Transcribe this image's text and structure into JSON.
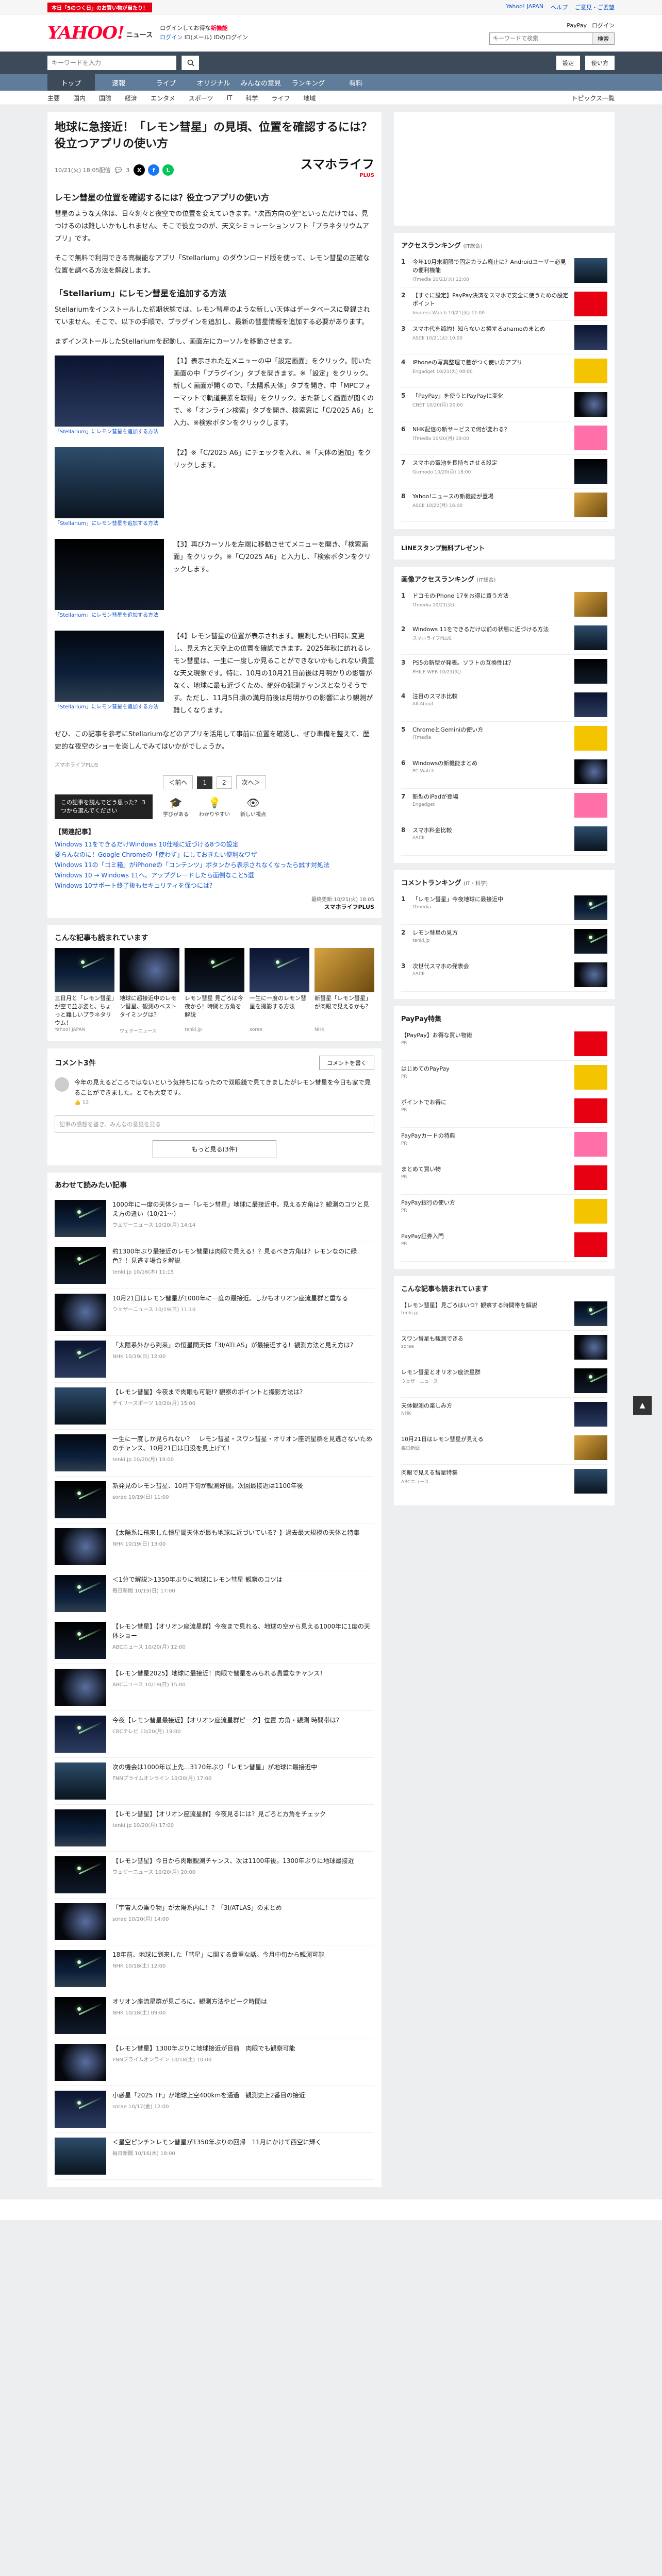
{
  "topbar": {
    "promo": "本日「5のつく日」のお買い物が当たり！",
    "links": [
      "Yahoo! JAPAN",
      "ヘルプ",
      "ご意見・ご要望"
    ]
  },
  "header": {
    "logo": "YAHOO!",
    "logo_sub": "JAPAN",
    "service": "ニュース",
    "line1_prefix": "ログインしてお得な",
    "line1_strong": "新機能",
    "line2": "ログイン",
    "line2_b": "ID(メール)",
    "line2_c": "IDのログイン",
    "search_placeholder": "キーワードで検索",
    "search_btn": "検索",
    "pay": "PayPay",
    "login": "ログイン"
  },
  "band": {
    "placeholder": "キーワードを入力",
    "settings": "設定",
    "help": "使い方"
  },
  "nav": [
    "トップ",
    "速報",
    "ライブ",
    "オリジナル",
    "みんなの意見",
    "ランキング",
    "有料"
  ],
  "subnav": [
    "主要",
    "国内",
    "国際",
    "経済",
    "エンタメ",
    "スポーツ",
    "IT",
    "科学",
    "ライフ",
    "地域"
  ],
  "subnav_topics": "トピックス一覧",
  "article": {
    "title": "地球に急接近！「レモン彗星」の見頃、位置を確認するには？役立つアプリの使い方",
    "date": "10/21(火) 18:05配信",
    "comments": "3",
    "media": "スマホライフ",
    "media_sub": "PLUS",
    "h2a": "レモン彗星の位置を確認するには？役立つアプリの使い方",
    "p1": "彗星のような天体は、日々刻々と夜空での位置を変えていきます。\"次西方向の空\"といっただけでは、見つけるのは難しいかもしれません。そこで役立つのが、天文シミュレーションソフト「プラネタリウムアプリ」です。",
    "p2": "そこで無料で利用できる高機能なアプリ「Stellarium」のダウンロード版を使って、レモン彗星の正確な位置を調べる方法を解説します。",
    "h2b": "「Stellarium」にレモン彗星を追加する方法",
    "p3": "Stellariumをインストールした初期状態では、レモン彗星のような新しい天体はデータベースに登録されていません。そこで、以下の手順で、プラグインを追加し、最新の彗星情報を追加する必要があります。",
    "p4": "まずインストールしたStellariumを起動し、画面左にカーソルを移動させます。",
    "steps": [
      {
        "text": "【1】表示された左メニューの中「設定画面」をクリック。開いた画面の中「プラグイン」タブを開きます。※「設定」をクリック。新しく画面が開くので、「太陽系天体」タブを開き、中「MPCフォーマットで軌道要素を取得」をクリック。また新しく画面が開くので、※「オンライン検索」タブを開き、検索窓に「C/2025 A6」と入力、※検索ボタンをクリックします。",
        "cap": "「Stellarium」にレモン彗星を追加する方法"
      },
      {
        "text": "【2】※「C/2025 A6」にチェックを入れ、※「天体の追加」をクリックします。",
        "cap": "「Stellarium」にレモン彗星を追加する方法"
      },
      {
        "text": "【3】再びカーソルを左端に移動させてメニューを開き、「検索画面」をクリック。※「C/2025 A6」と入力し、「検索ボタンをクリックします。",
        "cap": "「Stellarium」にレモン彗星を追加する方法"
      },
      {
        "text": "【4】レモン彗星の位置が表示されます。観測したい日時に変更し、見え方と天空上の位置を確認できます。2025年秋に訪れるレモン彗星は、一生に一度しか見ることができないかもしれない貴重な天文現象です。特に、10月の10月21日前後は月明かりの影響がなく、地球に最も近づくため、絶好の観測チャンスとなりそうです。ただし、11月5日頃の満月前後は月明かりの影響により観測が難しくなります。",
        "cap": "「Stellarium」にレモン彗星を追加する方法"
      }
    ],
    "p5": "ぜひ、この記事を参考にStellariumなどのアプリを活用して事前に位置を確認し、ぜひ準備を整えて、歴史的な夜空のショーを楽しんでみてはいかがでしょうか。",
    "writer": "スマホライフPLUS",
    "pager": [
      "＜前へ",
      "1",
      "2",
      "次へ＞"
    ],
    "quiz": "この記事を読んでどう思った？ 3つから選んでください",
    "reactions": [
      "学びがある",
      "わかりやすい",
      "新しい視点"
    ],
    "related_head": "【関連記事】",
    "related": [
      "Windows 11をできるだけWindows 10仕様に近づける8つの設定",
      "要らんなのに！Google Chromeの「使わず」にしておきたい便利なワザ",
      "Windows 11の「ゴミ箱」がiPhoneの「コンテンツ」ボタンから表示されなくなったら試す対処法",
      "Windows 10 → Windows 11へ、アップグレードしたら面倒なこと5選",
      "Windows 10サポート終了後もセキュリティを保つには？"
    ],
    "byline_date": "最終更新:10/21(火) 18:05",
    "byline_media": "スマホライフPLUS"
  },
  "recommend": {
    "head": "こんな記事も読まれています",
    "items": [
      {
        "title": "三日月と「レモン彗星」が空で並ぶ姿と、ちょっと難しいプラネタリウム！",
        "src": "Yahoo! JAPAN"
      },
      {
        "title": "地球に超接近中のレモン彗星、観測のベストタイミングは？",
        "src": "ウェザーニュース"
      },
      {
        "title": "レモン彗星 見ごろは今夜から！時間と方角を解説",
        "src": "tenki.jp"
      },
      {
        "title": "一生に一度のレモン彗星を撮影する方法",
        "src": "sorae"
      },
      {
        "title": "新彗星「レモン彗星」が肉眼で見えるかも？",
        "src": "NHK"
      }
    ]
  },
  "comments": {
    "head": "コメント3件",
    "sort": "おすすめ順",
    "write": "コメントを書く",
    "first": "今年の見えるどころではないという気持ちになったので双眼鏡で見てきましたがレモン彗星を今日も家で見ることができました。とても大変です。",
    "likes": "12",
    "ph": "記事の感想を書き、みんなの意見を見る",
    "more": "もっと見る(3件)"
  },
  "list": {
    "head": "あわせて読みたい記事",
    "items": [
      {
        "t": "1000年に一度の天体ショー「レモン彗星」地球に最接近中。見える方角は？観測のコツと見え方の違い（10/21～）",
        "s": "ウェザーニュース 10/20(月) 14:14"
      },
      {
        "t": "約1300年ぶり最接近のレモン彗星は肉眼で見える！？見るべき方角は？レモンなのに緑色？！見逃す場合を解説",
        "s": "tenki.jp 10/16(木) 11:15"
      },
      {
        "t": "10月21日はレモン彗星が1000年に一度の最接近。しかもオリオン座流星群と重なる",
        "s": "ウェザーニュース 10/19(日) 11:10"
      },
      {
        "t": "「太陽系外から到来」の恒星間天体「3I/ATLAS」が最接近する！観測方法と見え方は？",
        "s": "NHK 10/19(日) 12:00"
      },
      {
        "t": "【レモン彗星】今夜まで肉眼も可能!? 観察のポイントと撮影方法は？",
        "s": "デイリースポーツ 10/20(月) 15:00"
      },
      {
        "t": "一生に一度しか見られない？　レモン彗星・スワン彗星・オリオン座流星群を見逃さないためのチャンス、10月21日は日没を見上げて！",
        "s": "tenki.jp 10/20(月) 19:00"
      },
      {
        "t": "新発見のレモン彗星、10月下旬が観測好機。次回最接近は1100年後",
        "s": "sorae 10/19(日) 11:00"
      },
      {
        "t": "【太陽系に飛来した恒星間天体が最も地球に近づいている？】過去最大規模の天体と特集",
        "s": "NHK 10/19(日) 13:00"
      },
      {
        "t": "＜1分で解説＞1350年ぶりに地球にレモン彗星 観察のコツは",
        "s": "毎日新聞 10/19(日) 17:00"
      },
      {
        "t": "【レモン彗星】【オリオン座流星群】今夜まで見れる、地球の空から見える1000年に1度の天体ショー",
        "s": "ABCニュース 10/20(月) 12:00"
      },
      {
        "t": "【レモン彗星2025】地球に最接近！肉眼で彗星をみられる貴重なチャンス！",
        "s": "ABCニュース 10/19(日) 15:00"
      },
      {
        "t": "今夜【レモン彗星最接近】【オリオン座流星群ピーク】位置 方角・観測 時間帯は？",
        "s": "CBCテレビ 10/20(月) 19:00"
      },
      {
        "t": "次の機会は1000年以上先…3170年ぶり「レモン彗星」が地球に最接近中",
        "s": "FNNプライムオンライン 10/20(月) 17:00"
      },
      {
        "t": "【レモン彗星】【オリオン座流星群】今夜見るには？見ごろと方角をチェック",
        "s": "tenki.jp 10/20(月) 17:00"
      },
      {
        "t": "【レモン彗星】今日から肉眼観測チャンス、次は1100年後。1300年ぶりに地球最接近",
        "s": "ウェザーニュース 10/20(月) 20:00"
      },
      {
        "t": "「宇宙人の乗り物」が太陽系内に！？「3I/ATLAS」のまとめ",
        "s": "sorae 10/20(月) 14:00"
      },
      {
        "t": "18年前、地球に到来した「彗星」に関する貴重な話。今月中旬から観測可能",
        "s": "NHK 10/18(土) 12:00"
      },
      {
        "t": "オリオン座流星群が見ごろに。観測方法やピーク時間は",
        "s": "NHK 10/18(土) 09:00"
      },
      {
        "t": "【レモン彗星】1300年ぶりに地球接近が目前　肉眼でも観察可能",
        "s": "FNNプライムオンライン 10/18(土) 10:00"
      },
      {
        "t": "小惑星「2025 TF」が地球上空400kmを通過　観測史上2番目の接近",
        "s": "sorae 10/17(金) 12:00"
      },
      {
        "t": "＜星空ピンチ＞レモン彗星が1350年ぶりの回帰　11月にかけて西空に輝く",
        "s": "毎日新聞 10/16(木) 18:00"
      }
    ]
  },
  "right": {
    "access": {
      "head": "アクセスランキング",
      "sub": "(IT総合)",
      "items": [
        {
          "t": "今年10月末期限で固定カラム廃止に？Androidユーザー必見の便利機能",
          "s": "ITmedia 10/21(火) 12:00"
        },
        {
          "t": "【すぐに設定】PayPay決済をスマホで安全に使うための設定ポイント",
          "s": "Impress Watch 10/21(火) 11:00"
        },
        {
          "t": "スマホ代を節約！知らないと損するahamoのまとめ",
          "s": "ASCII 10/21(火) 10:00"
        },
        {
          "t": "iPhoneの写真整理で差がつく使い方アプリ",
          "s": "Engadget 10/21(火) 08:00"
        },
        {
          "t": "「PayPay」を使うとPayPayに変化",
          "s": "CNET 10/20(月) 20:00"
        },
        {
          "t": "NHK配信の新サービスで何が変わる？",
          "s": "ITmedia 10/20(月) 19:00"
        },
        {
          "t": "スマホの電池を長持ちさせる設定",
          "s": "Gizmodo 10/20(月) 18:00"
        },
        {
          "t": "Yahoo!ニュースの新機能が登場",
          "s": "ASCII 10/20(月) 16:00"
        }
      ]
    },
    "line": "LINEスタンプ無料プレゼント",
    "ranking": {
      "head": "画像アクセスランキング",
      "sub": "(IT総合)",
      "items": [
        {
          "t": "ドコモのiPhone 17をお得に買う方法",
          "s": "ITmedia 10/21(火)"
        },
        {
          "t": "Windows 11をできるだけ以前の状態に近づける方法",
          "s": "スマホライフPLUS"
        },
        {
          "t": "PS5の新型が発表。ソフトの互換性は？",
          "s": "PHILE WEB 10/21(火)"
        },
        {
          "t": "注目のスマホ比較",
          "s": "All About"
        },
        {
          "t": "ChromeとGeminiの使い方",
          "s": "ITmedia"
        },
        {
          "t": "Windowsの新機能まとめ",
          "s": "PC Watch"
        },
        {
          "t": "新型のiPadが登場",
          "s": "Engadget"
        },
        {
          "t": "スマホ料金比較",
          "s": "ASCII"
        }
      ]
    },
    "comment_rank": {
      "head": "コメントランキング",
      "sub": "(IT・科学)",
      "items": [
        {
          "t": "「レモン彗星」今夜地球に最接近中",
          "s": "ITmedia"
        },
        {
          "t": "レモン彗星の見方",
          "s": "tenki.jp"
        },
        {
          "t": "次世代スマホの発表会",
          "s": "ASCII"
        }
      ]
    },
    "promo_head": "PayPay特集",
    "promo": [
      {
        "t": "【PayPay】お得な買い物術",
        "s": "PR"
      },
      {
        "t": "はじめてのPayPay",
        "s": "PR"
      },
      {
        "t": "ポイントでお得に",
        "s": "PR"
      },
      {
        "t": "PayPayカードの特典",
        "s": "PR"
      },
      {
        "t": "まとめて買い物",
        "s": "PR"
      },
      {
        "t": "PayPay銀行の使い方",
        "s": "PR"
      },
      {
        "t": "PayPay証券入門",
        "s": "PR"
      }
    ],
    "related_head": "こんな記事も読まれています",
    "related": [
      {
        "t": "【レモン彗星】見ごろはいつ？観察する時間帯を解説",
        "s": "tenki.jp"
      },
      {
        "t": "スワン彗星も観測できる",
        "s": "sorae"
      },
      {
        "t": "レモン彗星とオリオン座流星群",
        "s": "ウェザーニュース"
      },
      {
        "t": "天体観測の楽しみ方",
        "s": "NHK"
      },
      {
        "t": "10月21日はレモン彗星が見える",
        "s": "毎日新聞"
      },
      {
        "t": "肉眼で見える彗星特集",
        "s": "ABCニュース"
      }
    ]
  },
  "pagetop": "▲"
}
